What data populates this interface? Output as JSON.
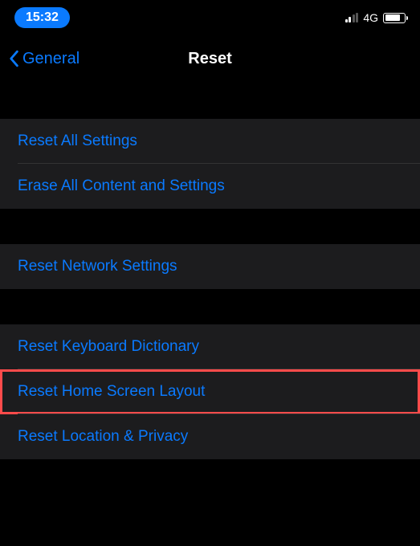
{
  "status": {
    "time": "15:32",
    "network": "4G"
  },
  "nav": {
    "back_label": "General",
    "title": "Reset"
  },
  "groups": [
    {
      "rows": [
        {
          "label": "Reset All Settings"
        },
        {
          "label": "Erase All Content and Settings"
        }
      ]
    },
    {
      "rows": [
        {
          "label": "Reset Network Settings"
        }
      ]
    },
    {
      "rows": [
        {
          "label": "Reset Keyboard Dictionary"
        },
        {
          "label": "Reset Home Screen Layout",
          "highlight": true
        },
        {
          "label": "Reset Location & Privacy"
        }
      ]
    }
  ]
}
